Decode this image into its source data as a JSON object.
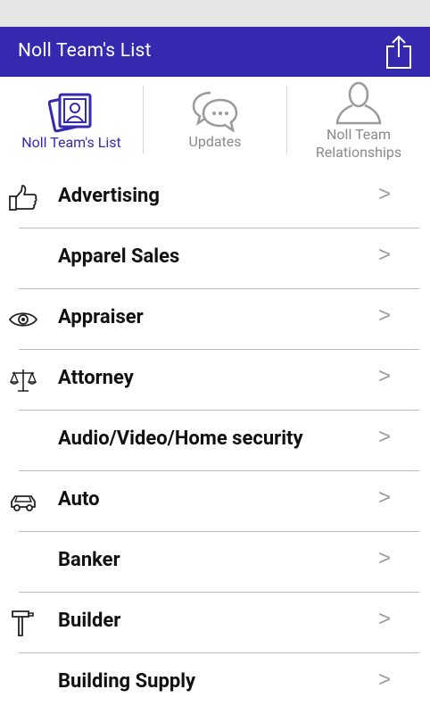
{
  "app_bar": {
    "title": "Noll Team's List",
    "share_icon": "share-icon"
  },
  "tabs": [
    {
      "label": "Noll Team's List",
      "icon": "photos-icon",
      "active": true
    },
    {
      "label": "Updates",
      "icon": "chat-bubbles-icon",
      "active": false
    },
    {
      "label_line1": "Noll Team",
      "label_line2": "Relationships",
      "icon": "person-icon",
      "active": false
    }
  ],
  "list": [
    {
      "label": "Advertising",
      "icon": "thumbs-up-icon",
      "chevron": ">"
    },
    {
      "label": "Apparel Sales",
      "icon": "",
      "chevron": ">"
    },
    {
      "label": "Appraiser",
      "icon": "eye-icon",
      "chevron": ">"
    },
    {
      "label": "Attorney",
      "icon": "scales-icon",
      "chevron": ">"
    },
    {
      "label": "Audio/Video/Home security",
      "icon": "",
      "chevron": ">"
    },
    {
      "label": "Auto",
      "icon": "car-icon",
      "chevron": ">"
    },
    {
      "label": "Banker",
      "icon": "",
      "chevron": ">"
    },
    {
      "label": "Builder",
      "icon": "hammer-icon",
      "chevron": ">"
    },
    {
      "label": "Building Supply",
      "icon": "",
      "chevron": ">"
    }
  ],
  "colors": {
    "primary": "#3529b0",
    "inactive": "#8a8a8a",
    "separator": "#b9b9b9"
  }
}
